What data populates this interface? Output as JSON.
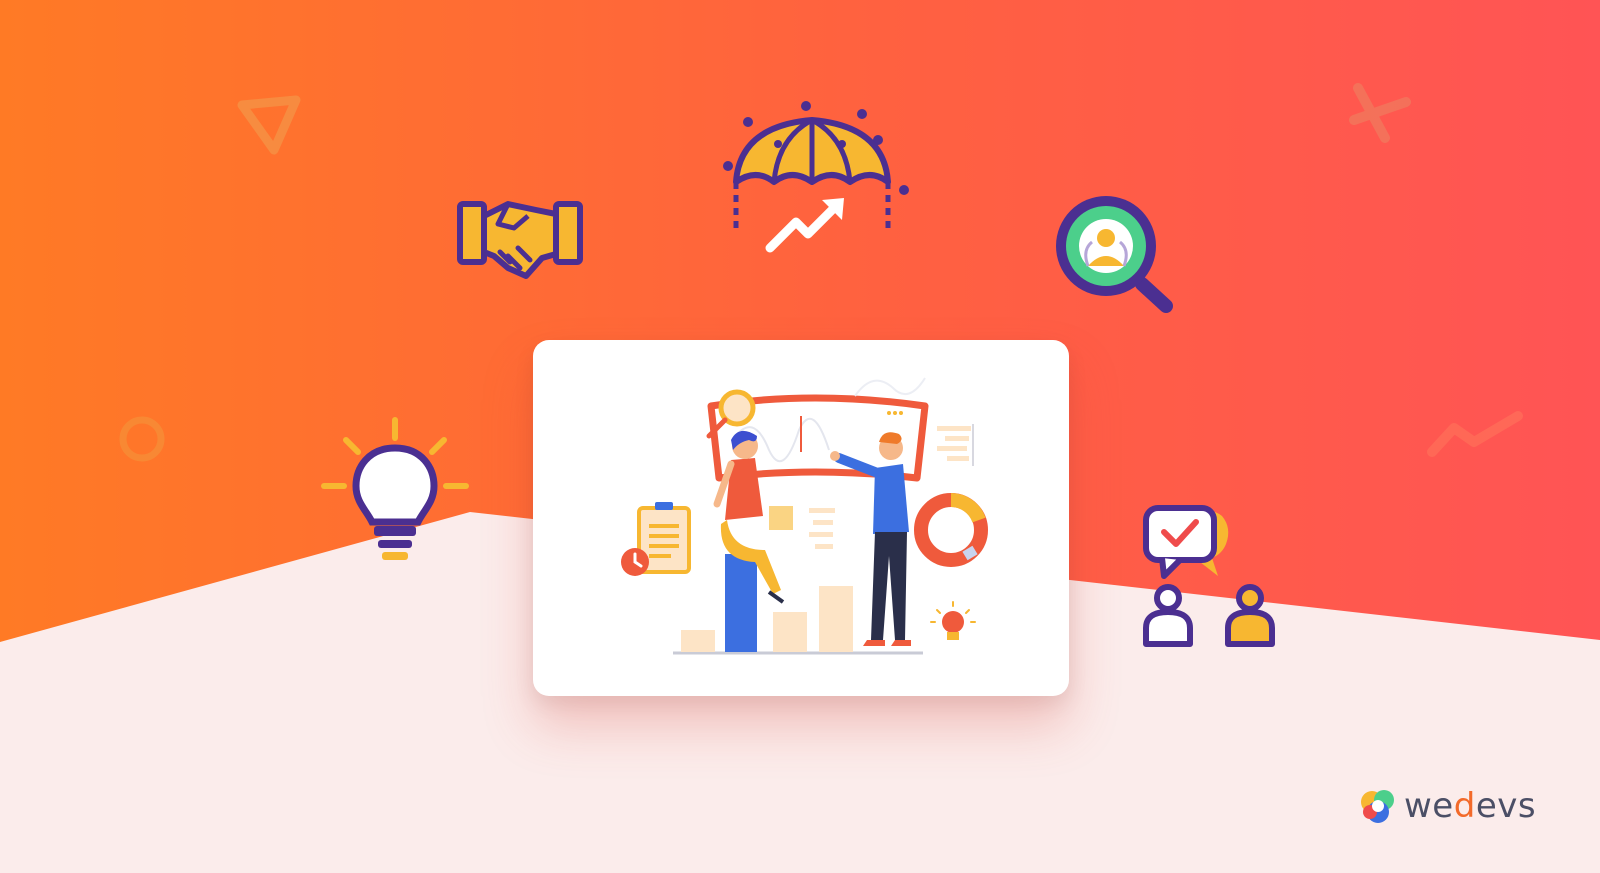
{
  "brand": {
    "logo_prefix": "we",
    "logo_accent": "d",
    "logo_suffix": "evs"
  },
  "colors": {
    "orange": "#ff7a2a",
    "coral": "#ff5a4f",
    "cream": "#fbeceb",
    "purple": "#4b2f91",
    "yellow": "#f7b731",
    "green": "#4ccf8b",
    "blue": "#3c6fe0"
  },
  "icons": [
    "handshake-icon",
    "umbrella-growth-icon",
    "candidate-search-icon",
    "lightbulb-icon",
    "team-chat-icon"
  ]
}
